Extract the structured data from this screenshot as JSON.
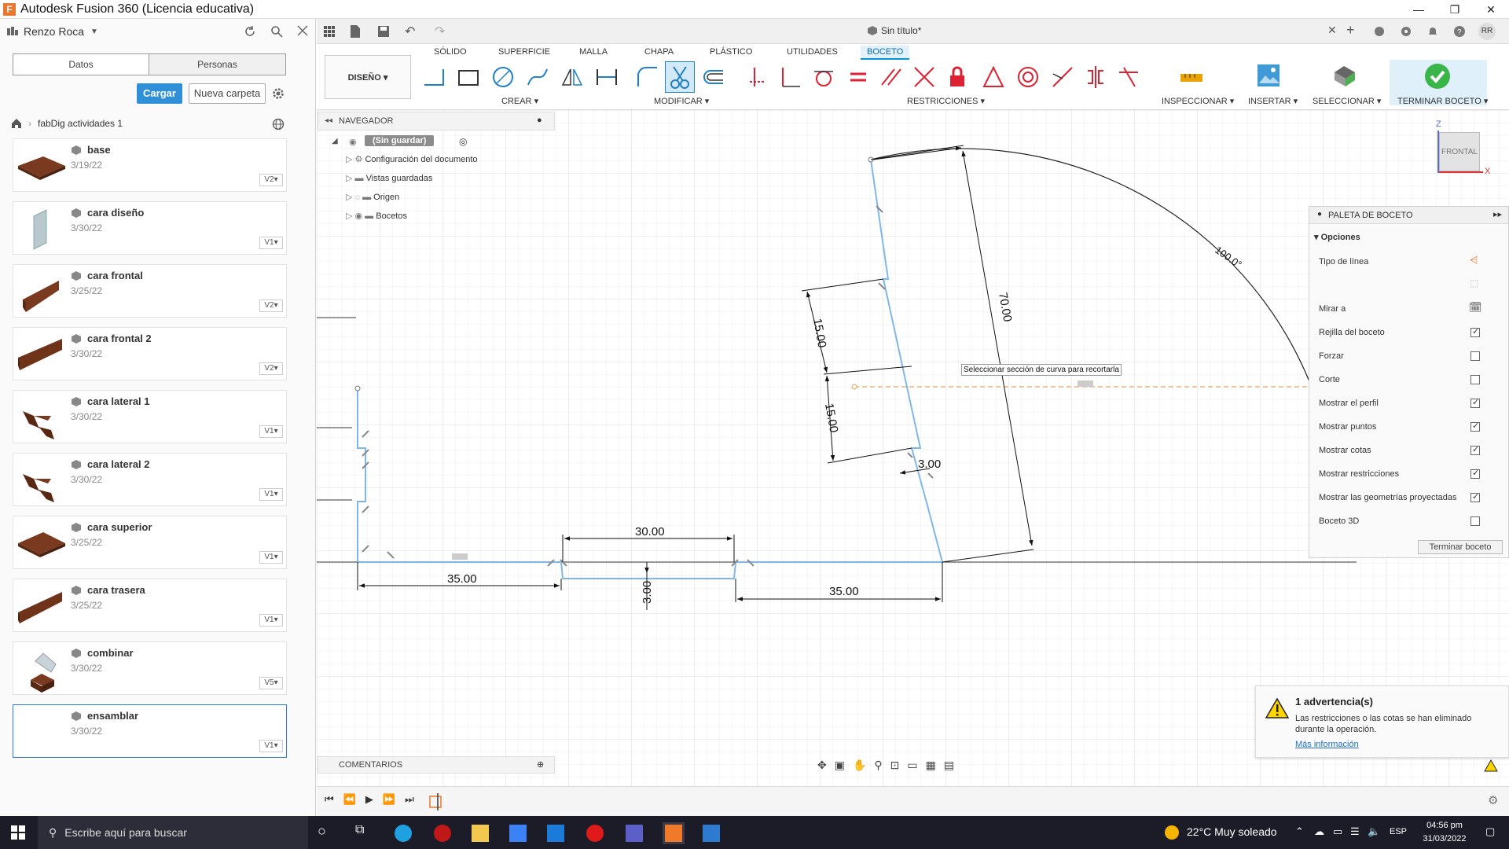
{
  "window": {
    "title": "Autodesk Fusion 360 (Licencia educativa)",
    "controls": [
      "—",
      "❐",
      "✕"
    ]
  },
  "data_panel": {
    "user": "Renzo Roca",
    "tabs": [
      "Datos",
      "Personas"
    ],
    "upload_label": "Cargar",
    "new_folder_label": "Nueva carpeta",
    "breadcrumb": "fabDig actividades 1",
    "items": [
      {
        "name": "base",
        "date": "3/19/22",
        "version": "V2"
      },
      {
        "name": "cara diseño",
        "date": "3/30/22",
        "version": "V1"
      },
      {
        "name": "cara frontal",
        "date": "3/25/22",
        "version": "V2"
      },
      {
        "name": "cara frontal 2",
        "date": "3/30/22",
        "version": "V2"
      },
      {
        "name": "cara lateral 1",
        "date": "3/30/22",
        "version": "V1"
      },
      {
        "name": "cara lateral 2",
        "date": "3/30/22",
        "version": "V1"
      },
      {
        "name": "cara superior",
        "date": "3/25/22",
        "version": "V1"
      },
      {
        "name": "cara trasera",
        "date": "3/25/22",
        "version": "V1"
      },
      {
        "name": "combinar",
        "date": "3/30/22",
        "version": "V5"
      },
      {
        "name": "ensamblar",
        "date": "3/30/22",
        "version": "V1"
      }
    ]
  },
  "document": {
    "title": "Sin título*",
    "user_initials": "RR"
  },
  "toolbar": {
    "tabs": [
      "SÓLIDO",
      "SUPERFICIE",
      "MALLA",
      "CHAPA",
      "PLÁSTICO",
      "UTILIDADES",
      "BOCETO"
    ],
    "active_tab": "BOCETO",
    "workspace": "DISEÑO",
    "groups": [
      "CREAR",
      "MODIFICAR",
      "RESTRICCIONES",
      "INSPECCIONAR",
      "INSERTAR",
      "SELECCIONAR",
      "TERMINAR BOCETO"
    ]
  },
  "browser": {
    "header": "NAVEGADOR",
    "root": "(Sin guardar)",
    "nodes": [
      "Configuración del documento",
      "Vistas guardadas",
      "Origen",
      "Bocetos"
    ]
  },
  "comments": {
    "label": "COMENTARIOS"
  },
  "viewcube": {
    "label": "FRONTAL",
    "z": "Z",
    "x": "X"
  },
  "sketch": {
    "tooltip": "Seleccionar sección de curva para recortarla",
    "dimensions": [
      "35.00",
      "30.00",
      "3.00",
      "35.00",
      "15.00",
      "15.00",
      "3.00",
      "70.00",
      "100.0°"
    ]
  },
  "palette": {
    "title": "PALETA DE BOCETO",
    "section": "Opciones",
    "rows": [
      {
        "label": "Tipo de línea",
        "checked": null
      },
      {
        "label": "Mirar a",
        "checked": null
      },
      {
        "label": "Rejilla del boceto",
        "checked": true
      },
      {
        "label": "Forzar",
        "checked": false
      },
      {
        "label": "Corte",
        "checked": false
      },
      {
        "label": "Mostrar el perfil",
        "checked": true
      },
      {
        "label": "Mostrar puntos",
        "checked": true
      },
      {
        "label": "Mostrar cotas",
        "checked": true
      },
      {
        "label": "Mostrar restricciones",
        "checked": true
      },
      {
        "label": "Mostrar las geometrías proyectadas",
        "checked": true
      },
      {
        "label": "Boceto 3D",
        "checked": false
      }
    ],
    "finish_label": "Terminar boceto"
  },
  "warning": {
    "title": "1 advertencia(s)",
    "body": "Las restricciones o las cotas se han eliminado durante la operación.",
    "link": "Más información"
  },
  "taskbar": {
    "search_placeholder": "Escribe aquí para buscar",
    "weather": "22°C  Muy soleado",
    "lang": "ESP",
    "time": "04:56 pm",
    "date": "31/03/2022"
  },
  "colors": {
    "accent": "#0696d7",
    "sketch": "#7fb8e8",
    "dim": "#111111"
  }
}
